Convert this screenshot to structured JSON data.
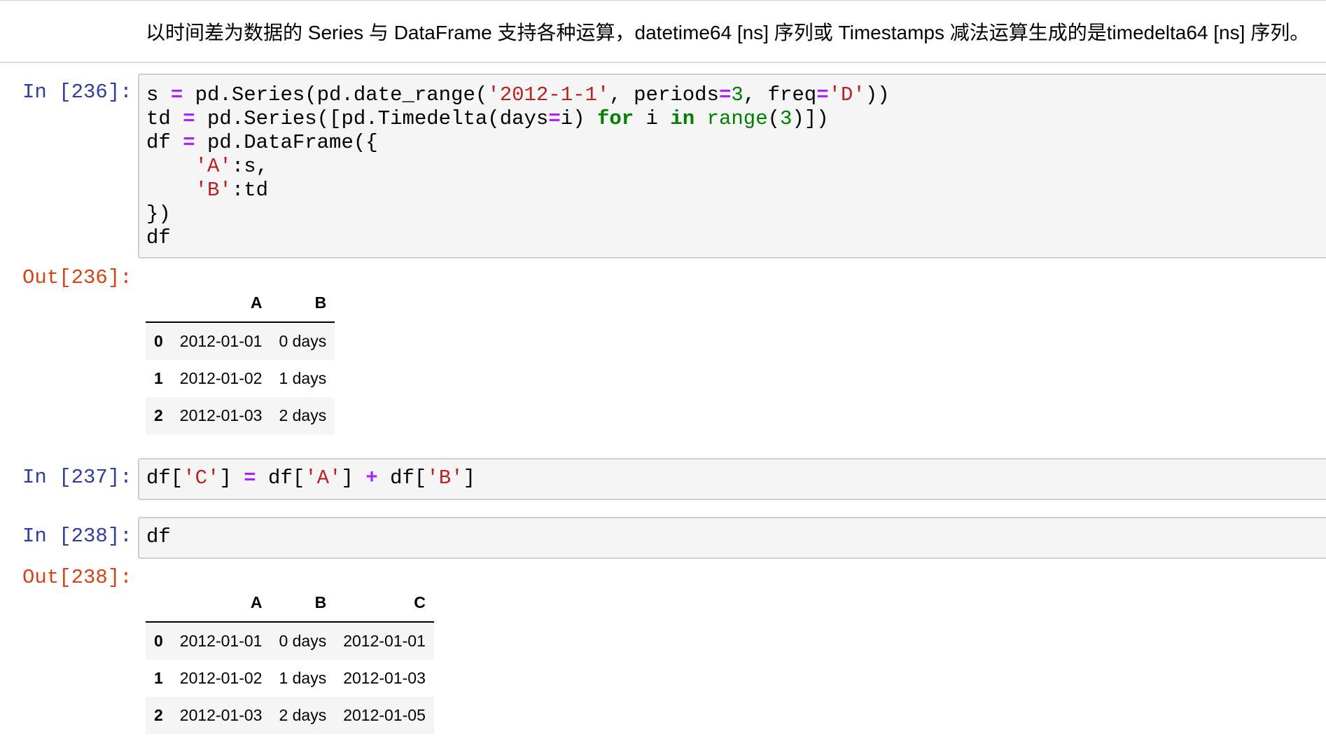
{
  "markdown": {
    "text": "以时间差为数据的 Series 与 DataFrame 支持各种运算，datetime64 [ns] 序列或 Timestamps 减法运算生成的是timedelta64 [ns] 序列。"
  },
  "cells": [
    {
      "prompt_in": "In [236]:",
      "prompt_out": "Out[236]:",
      "code_lines": [
        "s = pd.Series(pd.date_range('2012-1-1', periods=3, freq='D'))",
        "td = pd.Series([pd.Timedelta(days=i) for i in range(3)])",
        "df = pd.DataFrame({",
        "    'A':s,",
        "    'B':td",
        "})",
        "df"
      ],
      "output_table": {
        "columns": [
          "A",
          "B"
        ],
        "rows": [
          {
            "index": "0",
            "values": [
              "2012-01-01",
              "0 days"
            ]
          },
          {
            "index": "1",
            "values": [
              "2012-01-02",
              "1 days"
            ]
          },
          {
            "index": "2",
            "values": [
              "2012-01-03",
              "2 days"
            ]
          }
        ]
      }
    },
    {
      "prompt_in": "In [237]:",
      "code_lines": [
        "df['C'] = df['A'] + df['B']"
      ]
    },
    {
      "prompt_in": "In [238]:",
      "prompt_out": "Out[238]:",
      "code_lines": [
        "df"
      ],
      "output_table": {
        "columns": [
          "A",
          "B",
          "C"
        ],
        "rows": [
          {
            "index": "0",
            "values": [
              "2012-01-01",
              "0 days",
              "2012-01-01"
            ]
          },
          {
            "index": "1",
            "values": [
              "2012-01-02",
              "1 days",
              "2012-01-03"
            ]
          },
          {
            "index": "2",
            "values": [
              "2012-01-03",
              "2 days",
              "2012-01-05"
            ]
          }
        ]
      }
    }
  ],
  "colors": {
    "prompt_in": "#303f9f",
    "prompt_out": "#d84315",
    "keyword": "#008000",
    "string": "#ba2121",
    "operator": "#aa22ff"
  }
}
